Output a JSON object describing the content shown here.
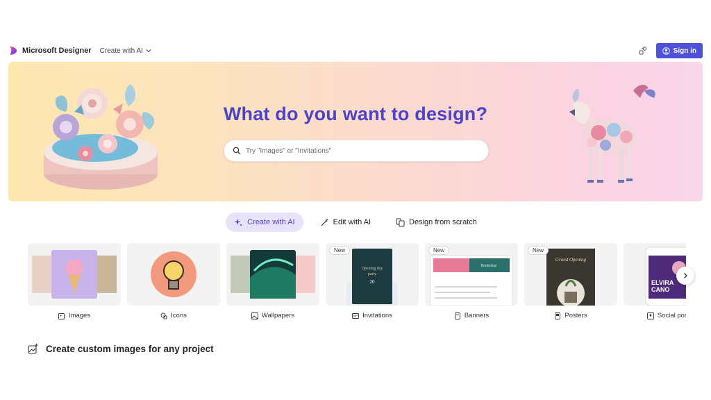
{
  "header": {
    "brand": "Microsoft Designer",
    "create_menu": "Create with AI",
    "signin_label": "Sign in",
    "accent": "#4f52d8"
  },
  "hero": {
    "title": "What do you want to design?",
    "search_placeholder": "Try \"Images\" or \"Invitations\"",
    "title_color": "#4c43c9"
  },
  "modes": [
    {
      "label": "Create with AI",
      "active": true,
      "icon": "sparkle-icon"
    },
    {
      "label": "Edit with AI",
      "active": false,
      "icon": "magic-wand-icon"
    },
    {
      "label": "Design from scratch",
      "active": false,
      "icon": "design-icon"
    }
  ],
  "cards": [
    {
      "label": "Images",
      "icon": "image-sparkle-icon",
      "badge": ""
    },
    {
      "label": "Icons",
      "icon": "icon-shapes-icon",
      "badge": ""
    },
    {
      "label": "Wallpapers",
      "icon": "wallpaper-icon",
      "badge": ""
    },
    {
      "label": "Invitations",
      "icon": "invitation-icon",
      "badge": "New",
      "thumb_text": [
        "Opening day",
        "party",
        "20"
      ]
    },
    {
      "label": "Banners",
      "icon": "banner-icon",
      "badge": "New",
      "thumb_text": [
        "Bookshop"
      ]
    },
    {
      "label": "Posters",
      "icon": "poster-icon",
      "badge": "New",
      "thumb_text": [
        "Grand Opening"
      ]
    },
    {
      "label": "Social posts",
      "icon": "social-icon",
      "badge": "",
      "thumb_text": [
        "ELVIRA",
        "CANO"
      ]
    }
  ],
  "section": {
    "title": "Create custom images for any project",
    "icon": "image-sparkle-icon"
  }
}
